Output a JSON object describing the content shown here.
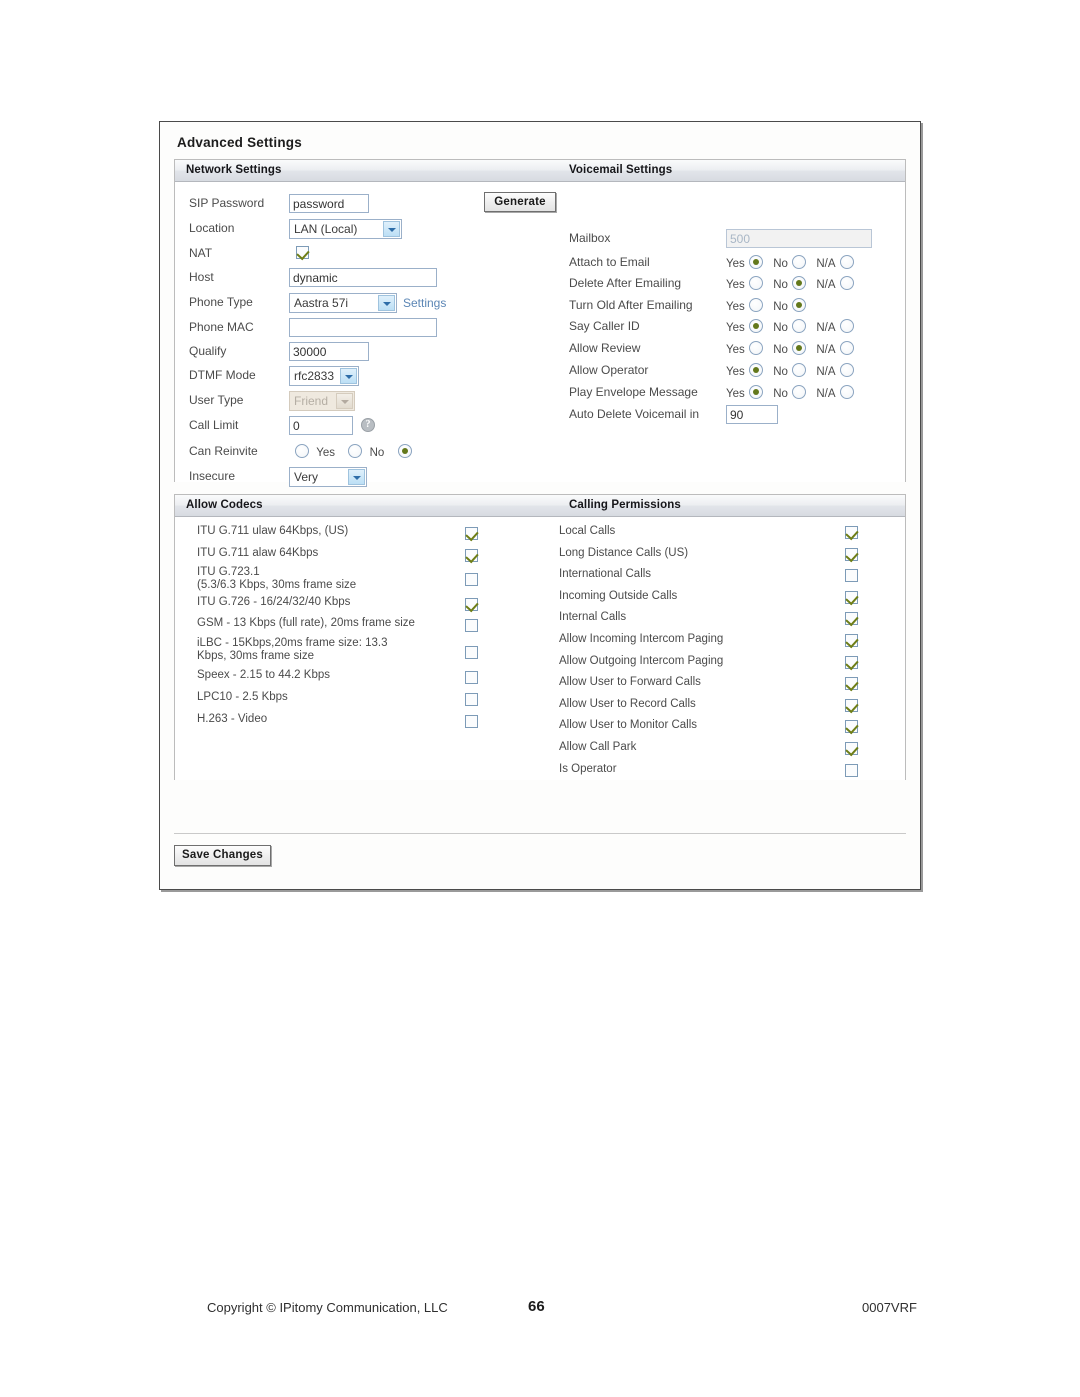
{
  "page": {
    "title": "Advanced Settings"
  },
  "sections": {
    "network": {
      "header": "Network Settings"
    },
    "voicemail": {
      "header": "Voicemail Settings"
    },
    "codecs": {
      "header": "Allow Codecs"
    },
    "permissions": {
      "header": "Calling Permissions"
    }
  },
  "network_settings": {
    "sip_password": {
      "label": "SIP Password",
      "value": "password"
    },
    "generate_button": "Generate",
    "location": {
      "label": "Location",
      "value": "LAN (Local)"
    },
    "nat": {
      "label": "NAT",
      "checked": true
    },
    "host": {
      "label": "Host",
      "value": "dynamic"
    },
    "phone_type": {
      "label": "Phone Type",
      "value": "Aastra 57i",
      "link": "Settings"
    },
    "phone_mac": {
      "label": "Phone MAC",
      "value": ""
    },
    "qualify": {
      "label": "Qualify",
      "value": "30000"
    },
    "dtmf_mode": {
      "label": "DTMF Mode",
      "value": "rfc2833"
    },
    "user_type": {
      "label": "User Type",
      "value": "Friend",
      "disabled": true
    },
    "call_limit": {
      "label": "Call Limit",
      "value": "0",
      "help_icon": "question-mark-icon"
    },
    "can_reinvite": {
      "label": "Can Reinvite",
      "options": [
        "Yes",
        "No"
      ],
      "selected": 2
    },
    "insecure": {
      "label": "Insecure",
      "value": "Very"
    }
  },
  "voicemail_settings": {
    "mailbox": {
      "label": "Mailbox",
      "value": "500",
      "disabled": true
    },
    "attach_to_email": {
      "label": "Attach to Email",
      "options": [
        "Yes",
        "No",
        "N/A"
      ],
      "selected": 0
    },
    "delete_after_emailing": {
      "label": "Delete After Emailing",
      "options": [
        "Yes",
        "No",
        "N/A"
      ],
      "selected": 1
    },
    "turn_old_after_emailing": {
      "label": "Turn Old After Emailing",
      "options": [
        "Yes",
        "No"
      ],
      "selected": 1
    },
    "say_caller_id": {
      "label": "Say Caller ID",
      "options": [
        "Yes",
        "No",
        "N/A"
      ],
      "selected": 0
    },
    "allow_review": {
      "label": "Allow Review",
      "options": [
        "Yes",
        "No",
        "N/A"
      ],
      "selected": 1
    },
    "allow_operator": {
      "label": "Allow Operator",
      "options": [
        "Yes",
        "No",
        "N/A"
      ],
      "selected": 0
    },
    "play_envelope_message": {
      "label": "Play Envelope Message",
      "options": [
        "Yes",
        "No",
        "N/A"
      ],
      "selected": 0
    },
    "auto_delete_voicemail_in": {
      "label": "Auto Delete Voicemail in",
      "value": "90"
    }
  },
  "codec_list": [
    {
      "label": "ITU G.711 ulaw 64Kbps, (US)",
      "checked": true
    },
    {
      "label": "ITU G.711 alaw 64Kbps",
      "checked": true
    },
    {
      "label": "ITU G.723.1\n(5.3/6.3 Kbps, 30ms frame size",
      "checked": false
    },
    {
      "label": "ITU G.726 - 16/24/32/40 Kbps",
      "checked": true
    },
    {
      "label": "GSM - 13 Kbps (full rate), 20ms frame size",
      "checked": false
    },
    {
      "label": "iLBC - 15Kbps,20ms frame size: 13.3\nKbps, 30ms frame size",
      "checked": false
    },
    {
      "label": "Speex - 2.15 to 44.2 Kbps",
      "checked": false
    },
    {
      "label": "LPC10 - 2.5 Kbps",
      "checked": false
    },
    {
      "label": "H.263 - Video",
      "checked": false
    }
  ],
  "permission_list": [
    {
      "label": "Local Calls",
      "checked": true
    },
    {
      "label": "Long Distance Calls (US)",
      "checked": true
    },
    {
      "label": "International Calls",
      "checked": false
    },
    {
      "label": "Incoming Outside Calls",
      "checked": true
    },
    {
      "label": "Internal Calls",
      "checked": true
    },
    {
      "label": "Allow Incoming Intercom Paging",
      "checked": true
    },
    {
      "label": "Allow Outgoing Intercom Paging",
      "checked": true
    },
    {
      "label": "Allow User to Forward Calls",
      "checked": true
    },
    {
      "label": "Allow User to Record Calls",
      "checked": true
    },
    {
      "label": "Allow User to Monitor Calls",
      "checked": true
    },
    {
      "label": "Allow Call Park",
      "checked": true
    },
    {
      "label": "Is Operator",
      "checked": false
    }
  ],
  "save_button": "Save Changes",
  "footer": {
    "copyright": "Copyright © IPitomy Communication, LLC",
    "page_number": "66",
    "document_code": "0007VRF"
  },
  "colors": {
    "link": "#5b86b5",
    "check": "#6e7e17",
    "radio_dot": "#63781b",
    "header_text": "#16161a"
  }
}
